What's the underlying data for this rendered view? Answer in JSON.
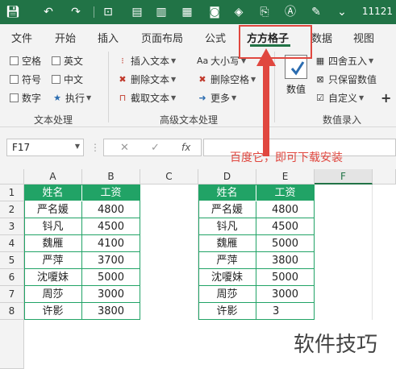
{
  "titlebar": {
    "title": "11121",
    "icons": [
      "save-icon",
      "undo-icon",
      "redo-icon",
      "record-icon",
      "form-icon",
      "chart-icon",
      "grid-icon",
      "camera-icon",
      "shapes-icon",
      "text-icon",
      "ai-icon",
      "brush-icon",
      "more-icon"
    ]
  },
  "tabs": [
    {
      "label": "文件"
    },
    {
      "label": "开始"
    },
    {
      "label": "插入"
    },
    {
      "label": "页面布局"
    },
    {
      "label": "公式"
    },
    {
      "label": "方方格子"
    },
    {
      "label": "数据"
    },
    {
      "label": "视图"
    }
  ],
  "ribbon": {
    "text_checks": [
      "空格",
      "英文",
      "符号",
      "中文",
      "数字"
    ],
    "exec_label": "执行",
    "insert_text": "插入文本",
    "delete_text": "删除文本",
    "extract_text": "截取文本",
    "font_size": "大小写",
    "delete_space": "删除空格",
    "more": "更多",
    "number_label": "数值",
    "round_label": "四舍五入",
    "keep_number": "只保留数值",
    "custom": "自定义",
    "plus": "+",
    "groups": [
      "文本处理",
      "高级文本处理",
      "数值录入"
    ]
  },
  "formula_bar": {
    "name_box": "F17",
    "fx": "fx",
    "cancel": "✕",
    "confirm": "✓"
  },
  "annotation": "百度它，即可下载安装",
  "grid": {
    "columns": [
      "A",
      "B",
      "C",
      "D",
      "E",
      "F"
    ],
    "rows": [
      "1",
      "2",
      "3",
      "4",
      "5",
      "6",
      "7",
      "8"
    ],
    "left_table": {
      "headers": [
        "姓名",
        "工资"
      ],
      "rows": [
        [
          "严名媛",
          "4800"
        ],
        [
          "钭凡",
          "4500"
        ],
        [
          "魏雁",
          "4100"
        ],
        [
          "严萍",
          "3700"
        ],
        [
          "沈嗄妹",
          "5000"
        ],
        [
          "周莎",
          "3000"
        ],
        [
          "许影",
          "3800"
        ]
      ]
    },
    "right_table": {
      "headers": [
        "姓名",
        "工资"
      ],
      "rows": [
        [
          "严名媛",
          "4800"
        ],
        [
          "钭凡",
          "4500"
        ],
        [
          "魏雁",
          "5000"
        ],
        [
          "严萍",
          "3800"
        ],
        [
          "沈嗄妹",
          "5000"
        ],
        [
          "周莎",
          "3000"
        ],
        [
          "许影",
          "3"
        ]
      ]
    }
  },
  "watermark": "软件技巧",
  "colors": {
    "brand": "#217346",
    "header_fill": "#21a366",
    "annotation": "#e0473f"
  }
}
